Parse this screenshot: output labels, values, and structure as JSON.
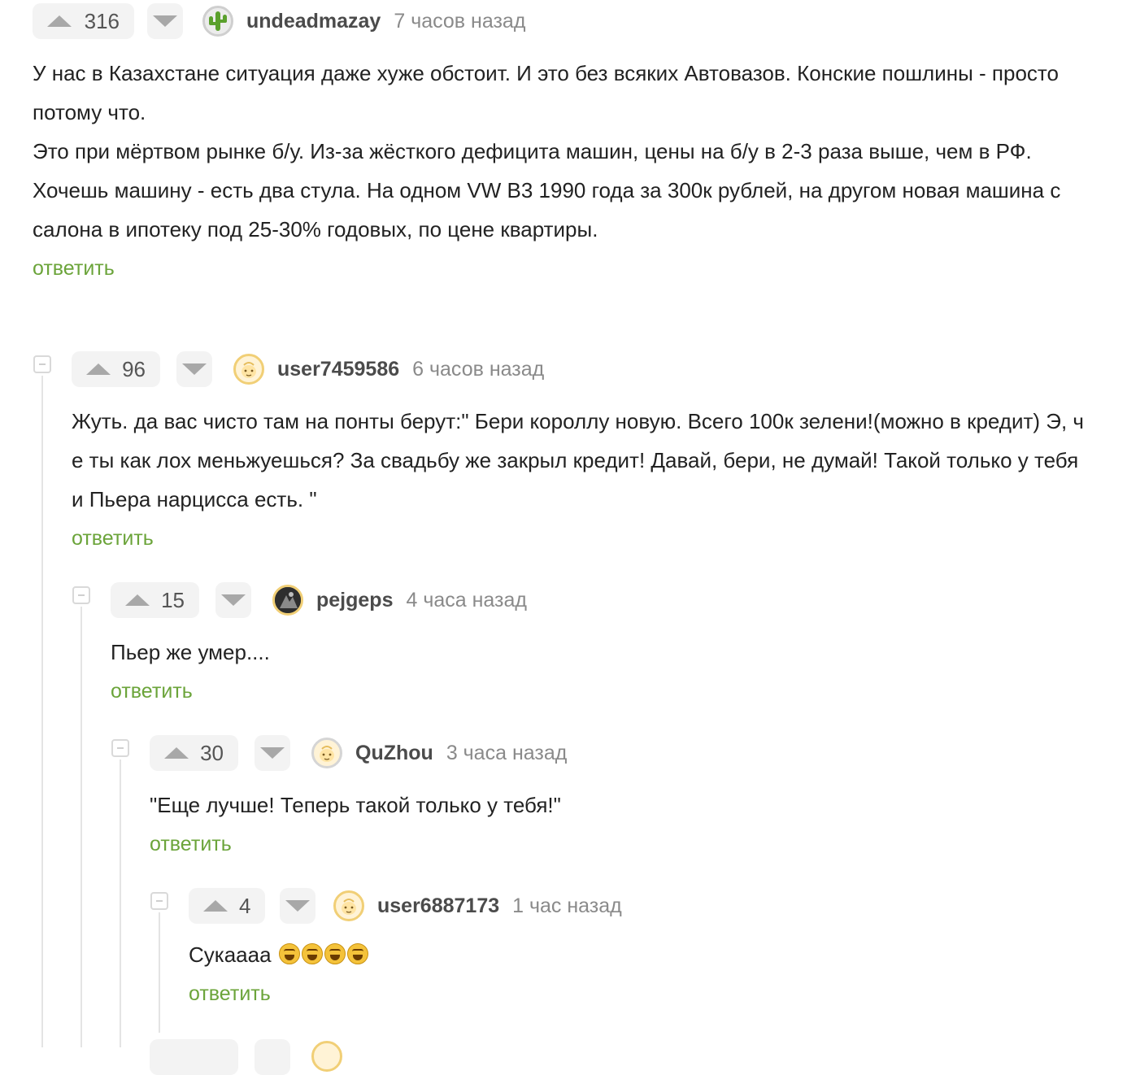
{
  "comments": [
    {
      "votes": "316",
      "author": "undeadmazay",
      "time": "7 часов назад",
      "paragraphs": [
        "У нас в Казахстане ситуация даже хуже обстоит. И это без всяких Автовазов. Конские пошлины - просто потому что.",
        "Это при мёртвом рынке б/у. Из-за жёсткого дефицита машин, цены на б/у в 2-3 раза выше, чем в РФ.",
        "Хочешь машину - есть два стула. На одном VW B3 1990 года за 300к рублей, на другом новая машина с салона в ипотеку под 25-30% годовых, по цене квартиры."
      ],
      "reply_label": "ответить",
      "avatar_icon": "cactus-avatar-icon"
    },
    {
      "votes": "96",
      "author": "user7459586",
      "time": "6 часов назад",
      "paragraphs": [
        "Жуть. да вас чисто там на понты берут:\" Бери короллу новую. Всего 100к зелени!(можно в кредит) Э, ч е ты как лох меньжуешься? За свадьбу же закрыл кредит! Давай, бери, не думай! Такой только у тебя и Пьера нарцисса есть. \""
      ],
      "reply_label": "ответить",
      "avatar_icon": "default-avatar-icon"
    },
    {
      "votes": "15",
      "author": "pejgeps",
      "time": "4 часа назад",
      "paragraphs": [
        "Пьер же умер...."
      ],
      "reply_label": "ответить",
      "avatar_icon": "photo-avatar-icon"
    },
    {
      "votes": "30",
      "author": "QuZhou",
      "time": "3 часа назад",
      "paragraphs": [
        "\"Еще лучше! Теперь такой только у тебя!\""
      ],
      "reply_label": "ответить",
      "avatar_icon": "default-avatar-icon"
    },
    {
      "votes": "4",
      "author": "user6887173",
      "time": "1 час назад",
      "paragraphs": [
        "Сукаааа"
      ],
      "emoji_count": 4,
      "reply_label": "ответить",
      "avatar_icon": "default-avatar-icon"
    }
  ],
  "colors": {
    "reply_link": "#6ba43a",
    "vote_bg": "#f3f3f3",
    "avatar_border": "#f1cf76"
  }
}
